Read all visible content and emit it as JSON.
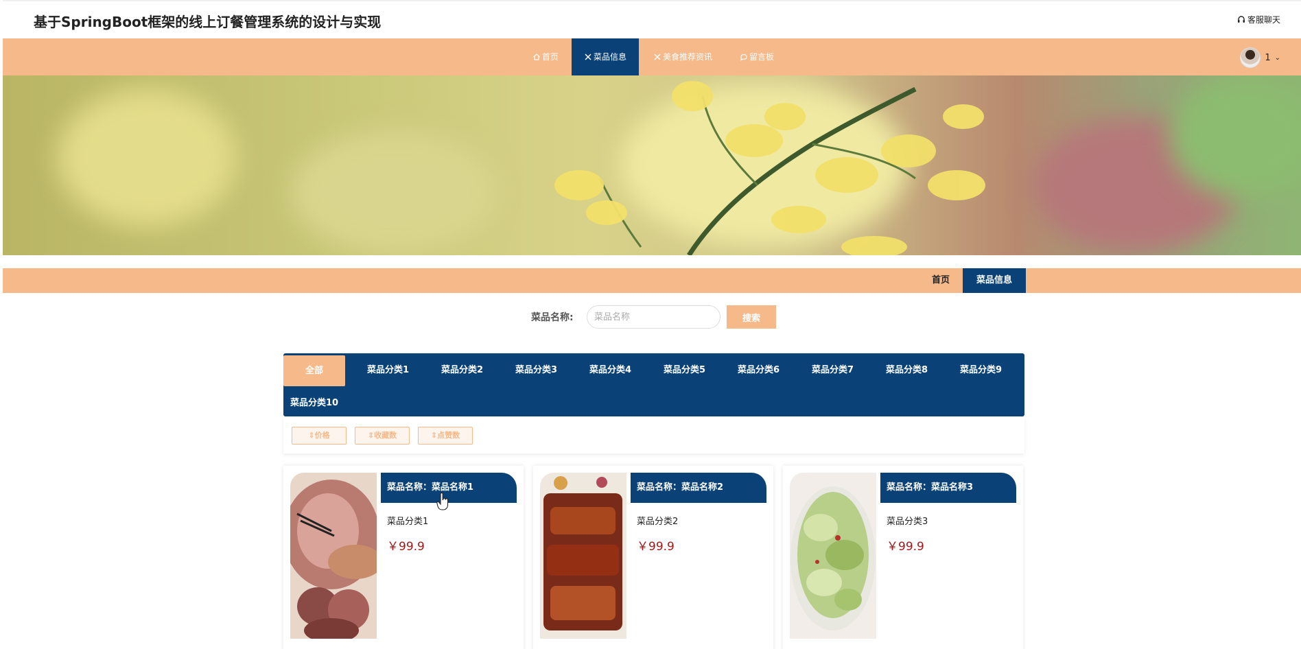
{
  "header": {
    "title": "基于SpringBoot框架的线上订餐管理系统的设计与实现",
    "service_label": "客服聊天",
    "service_icon": "headset-icon"
  },
  "nav": {
    "items": [
      {
        "label": "首页",
        "icon": "home-icon"
      },
      {
        "label": "菜品信息",
        "icon": "utensils-icon"
      },
      {
        "label": "美食推荐资讯",
        "icon": "utensils-icon"
      },
      {
        "label": "留言板",
        "icon": "chat-icon"
      }
    ],
    "active_index": 1,
    "user_name": "1"
  },
  "breadcrumb": {
    "items": [
      "首页",
      "菜品信息"
    ]
  },
  "search": {
    "label": "菜品名称:",
    "placeholder": "菜品名称",
    "button": "搜索"
  },
  "categories": {
    "items": [
      "全部",
      "菜品分类1",
      "菜品分类2",
      "菜品分类3",
      "菜品分类4",
      "菜品分类5",
      "菜品分类6",
      "菜品分类7",
      "菜品分类8",
      "菜品分类9",
      "菜品分类10"
    ],
    "active": "全部"
  },
  "sort": {
    "buttons": [
      "价格",
      "收藏数",
      "点赞数"
    ]
  },
  "products": [
    {
      "title": "菜品名称：菜品名称1",
      "category": "菜品分类1",
      "price": "￥99.9"
    },
    {
      "title": "菜品名称：菜品名称2",
      "category": "菜品分类2",
      "price": "￥99.9"
    },
    {
      "title": "菜品名称：菜品名称3",
      "category": "菜品分类3",
      "price": "￥99.9"
    }
  ],
  "colors": {
    "accent": "#f5b98a",
    "primary": "#0a4278",
    "price": "#a01818"
  }
}
